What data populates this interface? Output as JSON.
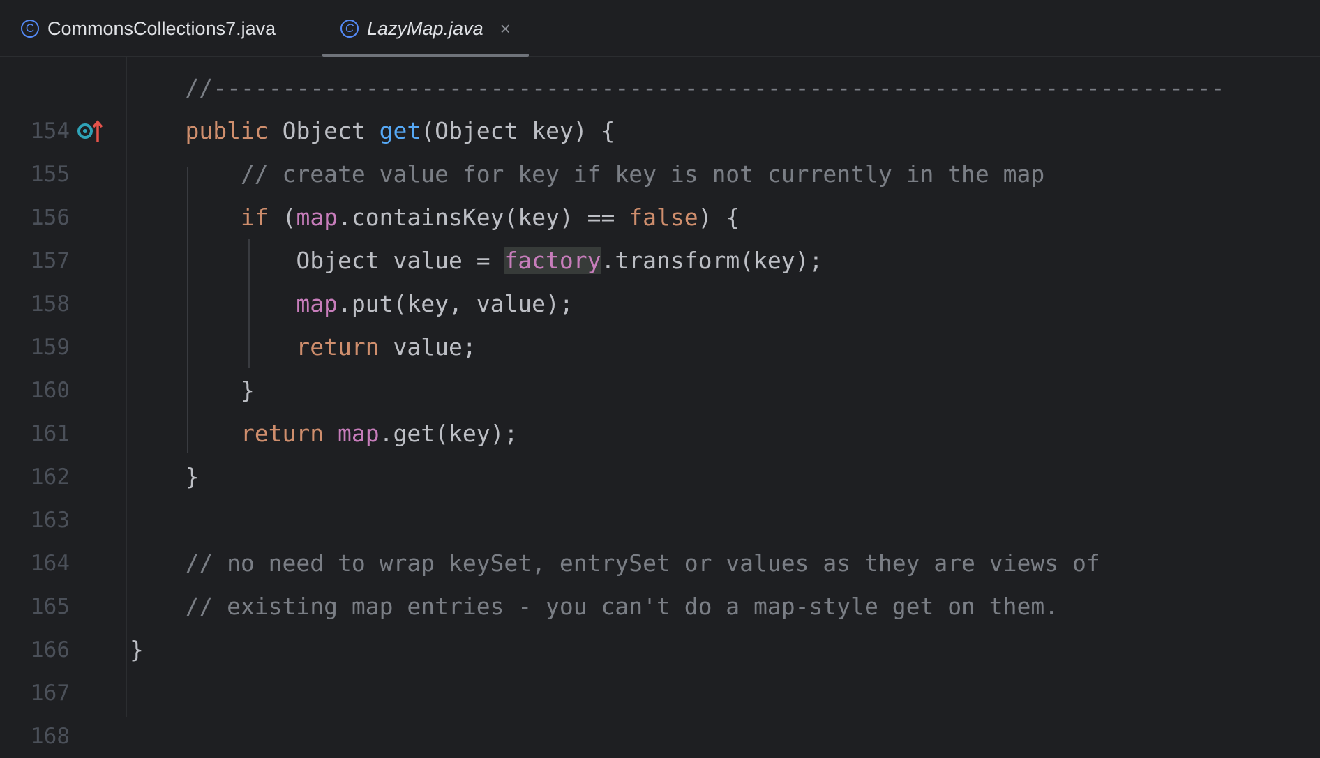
{
  "tabs": [
    {
      "label": "CommonsCollections7.java",
      "icon": "class-icon",
      "active": false
    },
    {
      "label": "LazyMap.java",
      "icon": "class-icon",
      "active": true,
      "closable": true
    }
  ],
  "tab_icon_glyph": "C",
  "tab_close_glyph": "×",
  "gutter_icons": {
    "line_155": "implementation-override-icon"
  },
  "colors": {
    "background": "#1e1f22",
    "keyword": "#cf8e6d",
    "function": "#56a8f5",
    "field": "#c77dbb",
    "comment": "#7a7e85",
    "text": "#bcbec4",
    "line_number": "#4b5059"
  },
  "lines": [
    {
      "n": "154",
      "t0": "    //-------------------------------------------------------------------------"
    },
    {
      "n": "155",
      "t0": "    ",
      "k0": "public",
      "t1": " Object ",
      "f0": "get",
      "t2": "(Object key) {"
    },
    {
      "n": "156",
      "c0": "        // create value for key if key is not currently in the map"
    },
    {
      "n": "157",
      "t0": "        ",
      "k0": "if",
      "t1": " (",
      "m0": "map",
      "t2": ".containsKey(key) == ",
      "k1": "false",
      "t3": ") {"
    },
    {
      "n": "158",
      "t0": "            Object value = ",
      "m0": "factory",
      "t1": ".transform(key);"
    },
    {
      "n": "159",
      "t0": "            ",
      "m0": "map",
      "t1": ".put(key, value);"
    },
    {
      "n": "160",
      "t0": "            ",
      "k0": "return",
      "t1": " value;"
    },
    {
      "n": "161",
      "t0": "        }"
    },
    {
      "n": "162",
      "t0": "        ",
      "k0": "return",
      "t1": " ",
      "m0": "map",
      "t2": ".get(key);"
    },
    {
      "n": "163",
      "t0": "    }"
    },
    {
      "n": "164"
    },
    {
      "n": "165",
      "c0": "    // no need to wrap keySet, entrySet or values as they are views of"
    },
    {
      "n": "166",
      "c0": "    // existing map entries - you can't do a map-style get on them."
    },
    {
      "n": "167",
      "t0": "}"
    },
    {
      "n": "168"
    }
  ]
}
